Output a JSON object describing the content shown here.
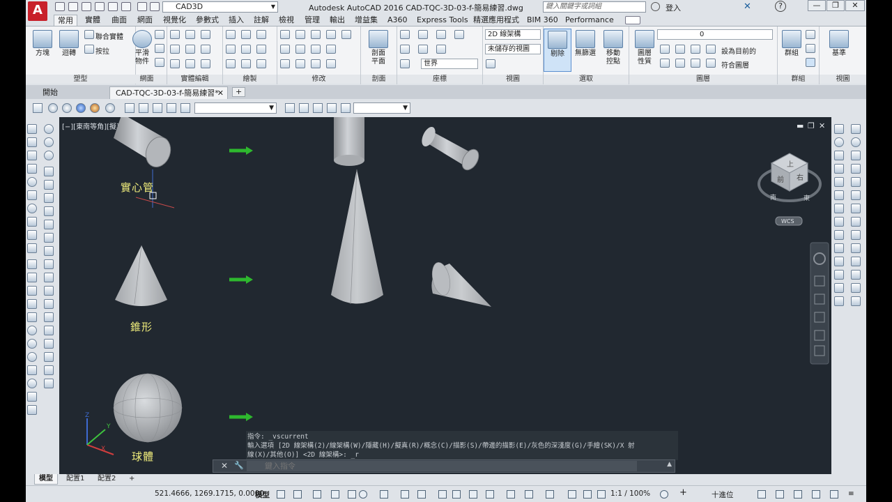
{
  "title_bar": {
    "app_logo": "A",
    "workspace": "CAD3D",
    "window_title": "Autodesk AutoCAD 2016    CAD-TQC-3D-03-f-簡易練習.dwg",
    "search_placeholder": "鍵入關鍵字或詞組",
    "signin": "登入"
  },
  "ribbon_tabs": [
    "常用",
    "實體",
    "曲面",
    "網面",
    "視覺化",
    "參數式",
    "插入",
    "註解",
    "檢視",
    "管理",
    "輸出",
    "增益集",
    "A360",
    "Express Tools",
    "精選應用程式",
    "BIM 360",
    "Performance"
  ],
  "ribbon": {
    "groups": [
      "塑型",
      "網面",
      "實體編輯",
      "繪製",
      "修改",
      "剖面",
      "座標",
      "視圖",
      "選取",
      "圖層",
      "群組",
      "視圖"
    ],
    "box_label": "方塊",
    "extrude_label": "迴轉",
    "union_label": "聯合實體",
    "presspull_label": "按拉",
    "smooth_label1": "平滑",
    "smooth_label2": "物件",
    "section_label1": "剖面",
    "section_label2": "平面",
    "visual_style": "2D 線架構",
    "unsaved_view": "未儲存的視圖",
    "world": "世界",
    "culling_label": "剔除",
    "nofilter_label": "無篩選",
    "gizmo_label1": "移動",
    "gizmo_label2": "控點",
    "layer_props_label1": "圖層",
    "layer_props_label2": "性質",
    "layer_current": "0",
    "make_current": "設為目前的",
    "match_layer": "符合圖層",
    "group_label": "群組",
    "base_label": "基準"
  },
  "doc_tabs": {
    "start": "開始",
    "drawing": "CAD-TQC-3D-03-f-簡易練習*",
    "add": "+"
  },
  "viewport": {
    "label": "[−][東南等角][擬真]",
    "shape_labels": {
      "cylinder": "實心管",
      "cone": "錐形",
      "sphere": "球體"
    },
    "viewcube": {
      "top": "上",
      "front": "前",
      "right": "右",
      "south": "南",
      "east": "東",
      "wcs": "WCS"
    },
    "ucs": {
      "x": "X",
      "y": "Y",
      "z": "Z"
    }
  },
  "command": {
    "history": [
      "指令: _vscurrent",
      "輸入選項 [2D 線架構(2)/線架構(W)/隱藏(H)/擬真(R)/概念(C)/描影(S)/帶邊的描影(E)/灰色的深淺度(G)/手繪(SK)/X 射",
      "線(X)/其他(O)] <2D 線架構>: _r"
    ],
    "placeholder": "鍵入指令"
  },
  "layout_tabs": [
    "模型",
    "配置1",
    "配置2",
    "+"
  ],
  "status": {
    "coords": "521.4666, 1269.1715, 0.0000",
    "model": "模型",
    "scale": "1:1 / 100%",
    "units": "十進位"
  },
  "colors": {
    "viewport_bg": "#212830",
    "arrow": "#2eb82e",
    "label": "#f1ee7c",
    "solid": "#b9bcc0"
  }
}
